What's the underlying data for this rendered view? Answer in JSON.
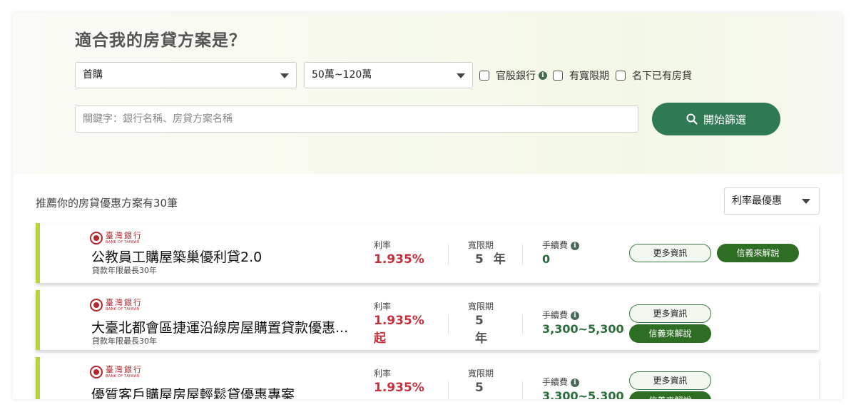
{
  "hero": {
    "title": "適合我的房貸方案是？",
    "purchase_type": "首購",
    "income_range": "50萬~120萬",
    "checkboxes": [
      {
        "label": "官股銀行",
        "checked": false,
        "has_info": true
      },
      {
        "label": "有寬限期",
        "checked": false
      },
      {
        "label": "名下已有房貸",
        "checked": false
      }
    ],
    "search_placeholder": "關鍵字：銀行名稱、房貸方案名稱",
    "search_button": "開始篩選"
  },
  "results": {
    "count_text": "推薦你的房貸優惠方案有30筆",
    "sort_value": "利率最優惠"
  },
  "labels": {
    "rate": "利率",
    "grace": "寬限期",
    "fee": "手續費",
    "more_info": "更多資訊",
    "explain": "信義來解說",
    "year_unit": "年",
    "from_suffix": "起"
  },
  "colors": {
    "accent_green": "#2f7a55",
    "rate_red": "#c82f3c",
    "fee_green": "#2a6d3a",
    "plan_border": "#b5d43b",
    "bank_red": "#b3262d"
  },
  "bank": {
    "name_cn": "臺灣銀行",
    "name_en": "BANK OF TAIWAN"
  },
  "plans": [
    {
      "title": "公教員工購屋築巢優利貸2.0",
      "term": "貸款年限最長30年",
      "rate": "1.935%",
      "grace_years": "5",
      "fee": "0"
    },
    {
      "title": "大臺北都會區捷運沿線房屋購置貸款優惠...",
      "term": "貸款年限最長30年",
      "rate": "1.935%",
      "grace_years": "5",
      "fee": "3,300~5,300"
    },
    {
      "title": "優質客戶購屋房屋輕鬆貸優惠專案",
      "term": "",
      "rate": "1.935%",
      "grace_years": "5",
      "fee": "3,300~5,300"
    }
  ]
}
